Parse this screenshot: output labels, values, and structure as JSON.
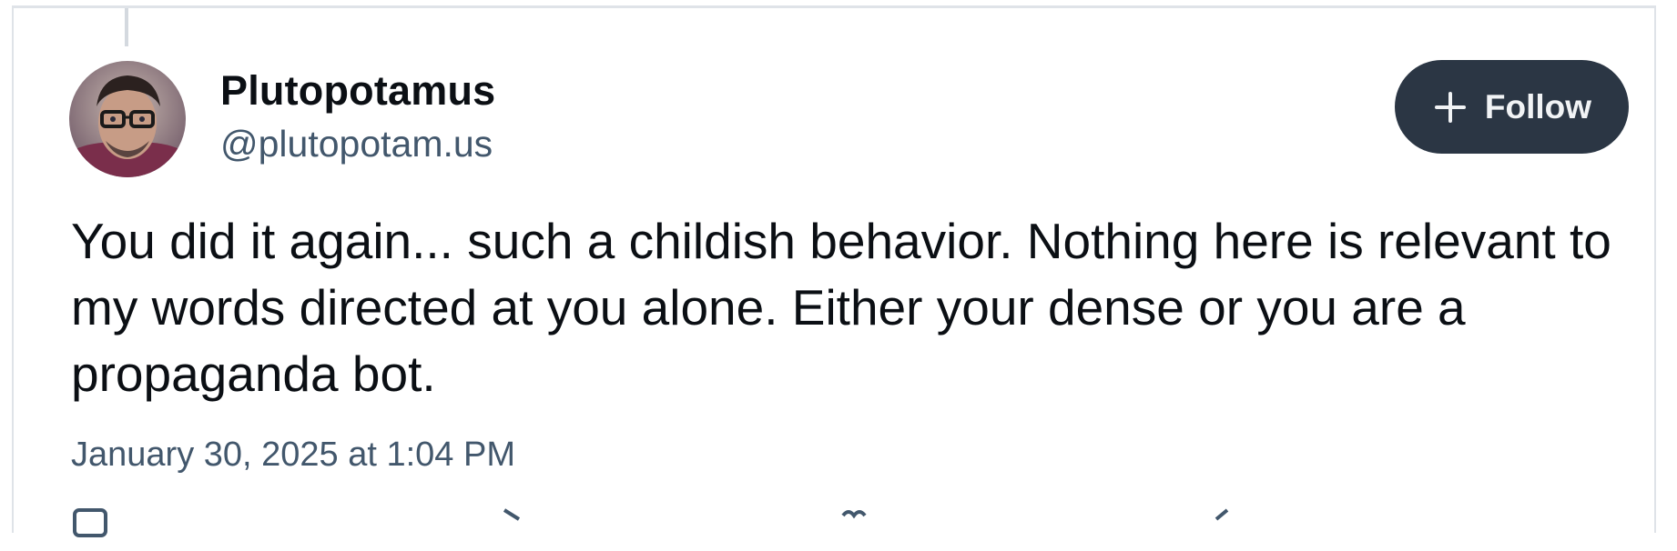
{
  "post": {
    "author": {
      "display_name": "Plutopotamus",
      "handle": "@plutopotam.us",
      "avatar_icon": "user-avatar"
    },
    "follow_button": {
      "label": "Follow",
      "icon": "plus-icon"
    },
    "text": "You did it again... such a childish behavior. Nothing here is relevant to my words directed at you alone. Either your dense or you are a propaganda bot.",
    "timestamp": "January 30, 2025 at 1:04 PM",
    "actions": [
      "reply-icon",
      "repost-icon",
      "like-icon",
      "share-icon"
    ]
  },
  "colors": {
    "follow_bg": "#2b3644",
    "muted_text": "#42576c",
    "border": "#dfe3e8"
  }
}
